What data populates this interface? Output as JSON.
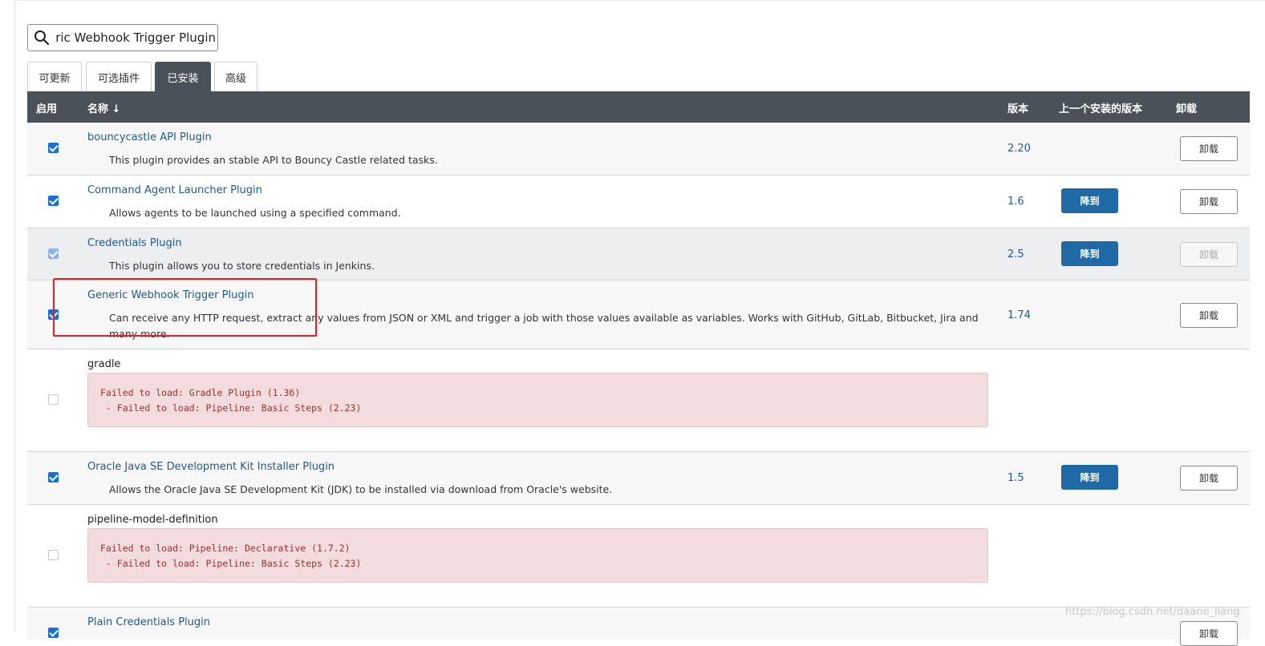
{
  "search": {
    "value": "Generic Webhook Trigger Plugin"
  },
  "tabs": [
    {
      "label": "可更新"
    },
    {
      "label": "可选插件"
    },
    {
      "label": "已安装"
    },
    {
      "label": "高级"
    }
  ],
  "active_tab": "已安装",
  "columns": {
    "enabled": "启用",
    "name": "名称 ↓",
    "version": "版本",
    "previous": "上一个安装的版本",
    "uninstall": "卸载"
  },
  "buttons": {
    "downgrade": "降到",
    "uninstall": "卸载"
  },
  "plugins": [
    {
      "name": "bouncycastle API Plugin",
      "desc": "This plugin provides an stable API to Bouncy Castle related tasks.",
      "version": "2.20",
      "enabled": true
    },
    {
      "name": "Command Agent Launcher Plugin",
      "desc": "Allows agents to be launched using a specified command.",
      "version": "1.6",
      "enabled": true
    },
    {
      "name": "Credentials Plugin",
      "desc": "This plugin allows you to store credentials in Jenkins.",
      "version": "2.5",
      "enabled": true
    },
    {
      "name": "Generic Webhook Trigger Plugin",
      "desc": "Can receive any HTTP request, extract any values from JSON or XML and trigger a job with those values available as variables. Works with GitHub, GitLab, Bitbucket, Jira and many more.",
      "version": "1.74",
      "enabled": true
    },
    {
      "name": "gradle",
      "errors": [
        "Failed to load: Gradle Plugin (1.36)",
        " - Failed to load: Pipeline: Basic Steps (2.23)"
      ],
      "enabled": false
    },
    {
      "name": "Oracle Java SE Development Kit Installer Plugin",
      "desc": "Allows the Oracle Java SE Development Kit (JDK) to be installed via download from Oracle's website.",
      "version": "1.5",
      "enabled": true
    },
    {
      "name": "pipeline-model-definition",
      "errors": [
        "Failed to load: Pipeline: Declarative (1.7.2)",
        " - Failed to load: Pipeline: Basic Steps (2.23)"
      ],
      "enabled": false
    },
    {
      "name": "Plain Credentials Plugin",
      "enabled": true
    }
  ],
  "watermark": "https://blog.csdn.net/daane_liang",
  "colors": {
    "header_bg": "#4a5158",
    "link": "#1e5a93",
    "downgrade_button": "#1f6aa6",
    "error_bg": "#f2dcdd",
    "error_text": "#a03030",
    "highlight_box": "#e52020"
  }
}
